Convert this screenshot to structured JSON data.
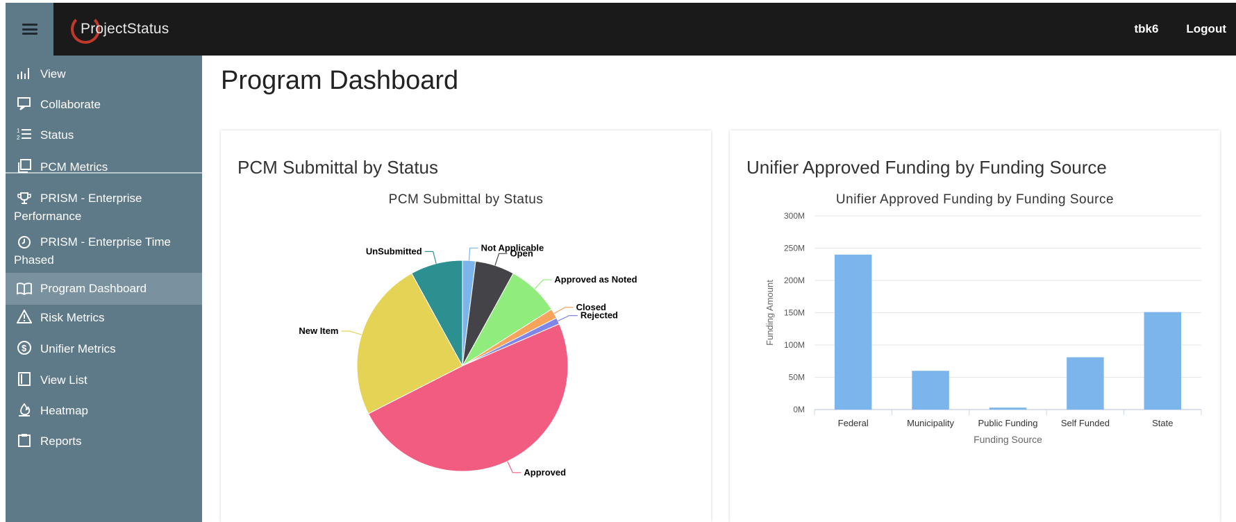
{
  "header": {
    "app_name": "ProjectStatus",
    "user": "tbk6",
    "logout_label": "Logout"
  },
  "sidebar": {
    "items": [
      {
        "label": "View",
        "icon": "bar-chart-icon"
      },
      {
        "label": "Collaborate",
        "icon": "chat-icon"
      },
      {
        "label": "Status",
        "icon": "numbered-list-icon"
      },
      {
        "label": "PCM Metrics",
        "icon": "copy-icon"
      },
      {
        "label": "PRISM - Enterprise Performance",
        "line1": "PRISM - Enterprise",
        "line2": "Performance",
        "icon": "trophy-icon"
      },
      {
        "label": "PRISM - Enterprise Time Phased",
        "line1": "PRISM - Enterprise Time",
        "line2": "Phased",
        "icon": "clock-icon"
      },
      {
        "label": "Program Dashboard",
        "icon": "book-icon",
        "active": true
      },
      {
        "label": "Risk Metrics",
        "icon": "warning-icon"
      },
      {
        "label": "Unifier Metrics",
        "icon": "dollar-icon"
      },
      {
        "label": "View List",
        "icon": "list-book-icon"
      },
      {
        "label": "Heatmap",
        "icon": "fire-icon"
      },
      {
        "label": "Reports",
        "icon": "clipboard-icon"
      }
    ]
  },
  "main": {
    "page_title": "Program Dashboard"
  },
  "cards": {
    "pcm": {
      "title": "PCM Submittal by Status"
    },
    "unifier": {
      "title": "Unifier Approved Funding by Funding Source"
    }
  },
  "chart_data": [
    {
      "type": "pie",
      "title": "PCM Submittal by Status",
      "slices": [
        {
          "label": "Not Applicable",
          "value": 2,
          "color": "#7cb5ec"
        },
        {
          "label": "Open",
          "value": 6,
          "color": "#434348"
        },
        {
          "label": "Approved as Noted",
          "value": 8,
          "color": "#90ed7d"
        },
        {
          "label": "Closed",
          "value": 1.5,
          "color": "#f7a35c"
        },
        {
          "label": "Rejected",
          "value": 1,
          "color": "#8085e9"
        },
        {
          "label": "Approved",
          "value": 49,
          "color": "#f15c80"
        },
        {
          "label": "New Item",
          "value": 24.5,
          "color": "#e4d354"
        },
        {
          "label": "UnSubmitted",
          "value": 8,
          "color": "#2b908f"
        }
      ]
    },
    {
      "type": "bar",
      "title": "Unifier Approved Funding by Funding Source",
      "xlabel": "Funding Source",
      "ylabel": "Funding Amount",
      "categories": [
        "Federal",
        "Municipality",
        "Public Funding",
        "Self Funded",
        "State"
      ],
      "values": [
        240,
        60,
        3,
        81,
        151
      ],
      "ylim": [
        0,
        300
      ],
      "yticks": [
        "0M",
        "50M",
        "100M",
        "150M",
        "200M",
        "250M",
        "300M"
      ],
      "bar_color": "#7cb5ec",
      "grid": true
    }
  ]
}
